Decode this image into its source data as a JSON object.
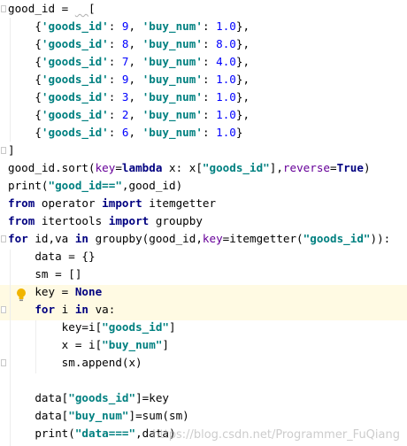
{
  "code_lines": [
    [
      {
        "t": "good_id = "
      },
      {
        "t": "  ",
        "c": "squig"
      },
      {
        "t": "["
      }
    ],
    [
      {
        "t": "    {"
      },
      {
        "t": "'goods_id'",
        "c": "str"
      },
      {
        "t": ": "
      },
      {
        "t": "9",
        "c": "num"
      },
      {
        "t": ", "
      },
      {
        "t": "'buy_num'",
        "c": "str"
      },
      {
        "t": ": "
      },
      {
        "t": "1.0",
        "c": "num"
      },
      {
        "t": "},"
      }
    ],
    [
      {
        "t": "    {"
      },
      {
        "t": "'goods_id'",
        "c": "str"
      },
      {
        "t": ": "
      },
      {
        "t": "8",
        "c": "num"
      },
      {
        "t": ", "
      },
      {
        "t": "'buy_num'",
        "c": "str"
      },
      {
        "t": ": "
      },
      {
        "t": "8.0",
        "c": "num"
      },
      {
        "t": "},"
      }
    ],
    [
      {
        "t": "    {"
      },
      {
        "t": "'goods_id'",
        "c": "str"
      },
      {
        "t": ": "
      },
      {
        "t": "7",
        "c": "num"
      },
      {
        "t": ", "
      },
      {
        "t": "'buy_num'",
        "c": "str"
      },
      {
        "t": ": "
      },
      {
        "t": "4.0",
        "c": "num"
      },
      {
        "t": "},"
      }
    ],
    [
      {
        "t": "    {"
      },
      {
        "t": "'goods_id'",
        "c": "str"
      },
      {
        "t": ": "
      },
      {
        "t": "9",
        "c": "num"
      },
      {
        "t": ", "
      },
      {
        "t": "'buy_num'",
        "c": "str"
      },
      {
        "t": ": "
      },
      {
        "t": "1.0",
        "c": "num"
      },
      {
        "t": "},"
      }
    ],
    [
      {
        "t": "    {"
      },
      {
        "t": "'goods_id'",
        "c": "str"
      },
      {
        "t": ": "
      },
      {
        "t": "3",
        "c": "num"
      },
      {
        "t": ", "
      },
      {
        "t": "'buy_num'",
        "c": "str"
      },
      {
        "t": ": "
      },
      {
        "t": "1.0",
        "c": "num"
      },
      {
        "t": "},"
      }
    ],
    [
      {
        "t": "    {"
      },
      {
        "t": "'goods_id'",
        "c": "str"
      },
      {
        "t": ": "
      },
      {
        "t": "2",
        "c": "num"
      },
      {
        "t": ", "
      },
      {
        "t": "'buy_num'",
        "c": "str"
      },
      {
        "t": ": "
      },
      {
        "t": "1.0",
        "c": "num"
      },
      {
        "t": "},"
      }
    ],
    [
      {
        "t": "    {"
      },
      {
        "t": "'goods_id'",
        "c": "str"
      },
      {
        "t": ": "
      },
      {
        "t": "6",
        "c": "num"
      },
      {
        "t": ", "
      },
      {
        "t": "'buy_num'",
        "c": "str"
      },
      {
        "t": ": "
      },
      {
        "t": "1.0",
        "c": "num"
      },
      {
        "t": "}"
      }
    ],
    [
      {
        "t": "]"
      }
    ],
    [
      {
        "t": "good_id.sort("
      },
      {
        "t": "key",
        "c": "kwarg"
      },
      {
        "t": "="
      },
      {
        "t": "lambda",
        "c": "kw"
      },
      {
        "t": " x: x["
      },
      {
        "t": "\"goods_id\"",
        "c": "str"
      },
      {
        "t": "],"
      },
      {
        "t": "reverse",
        "c": "kwarg"
      },
      {
        "t": "="
      },
      {
        "t": "True",
        "c": "kw"
      },
      {
        "t": ")"
      }
    ],
    [
      {
        "t": "print("
      },
      {
        "t": "\"good_id==\"",
        "c": "str"
      },
      {
        "t": ",good_id)"
      }
    ],
    [
      {
        "t": "from",
        "c": "kw"
      },
      {
        "t": " operator "
      },
      {
        "t": "import",
        "c": "kw"
      },
      {
        "t": " itemgetter"
      }
    ],
    [
      {
        "t": "from",
        "c": "kw"
      },
      {
        "t": " itertools "
      },
      {
        "t": "import",
        "c": "kw"
      },
      {
        "t": " groupby"
      }
    ],
    [
      {
        "t": "for",
        "c": "kw"
      },
      {
        "t": " id,va "
      },
      {
        "t": "in",
        "c": "kw"
      },
      {
        "t": " groupby(good_id,"
      },
      {
        "t": "key",
        "c": "kwarg"
      },
      {
        "t": "=itemgetter("
      },
      {
        "t": "\"goods_id\"",
        "c": "str"
      },
      {
        "t": ")):"
      }
    ],
    [
      {
        "t": "    data = {}"
      }
    ],
    [
      {
        "t": "    sm = []"
      }
    ],
    [
      {
        "t": "    key = "
      },
      {
        "t": "None",
        "c": "kw"
      }
    ],
    [
      {
        "t": "    "
      },
      {
        "t": "for",
        "c": "kw"
      },
      {
        "t": " i "
      },
      {
        "t": "in",
        "c": "kw"
      },
      {
        "t": " va:"
      }
    ],
    [
      {
        "t": "        key=i["
      },
      {
        "t": "\"goods_id\"",
        "c": "str"
      },
      {
        "t": "]"
      }
    ],
    [
      {
        "t": "        x = i["
      },
      {
        "t": "\"buy_num\"",
        "c": "str"
      },
      {
        "t": "]"
      }
    ],
    [
      {
        "t": "        sm.append(x)"
      }
    ],
    [
      {
        "t": ""
      }
    ],
    [
      {
        "t": "    data["
      },
      {
        "t": "\"goods_id\"",
        "c": "str"
      },
      {
        "t": "]=key"
      }
    ],
    [
      {
        "t": "    data["
      },
      {
        "t": "\"buy_num\"",
        "c": "str"
      },
      {
        "t": "]=sum(sm)"
      }
    ],
    [
      {
        "t": "    print("
      },
      {
        "t": "\"data===\"",
        "c": "str"
      },
      {
        "t": ",data)"
      }
    ]
  ],
  "watermark": "https://blog.csdn.net/Programmer_FuQiang",
  "colors": {
    "keyword": "#000080",
    "string": "#008080",
    "number": "#0000ff",
    "kwarg": "#660099",
    "current_line": "#fffae3"
  },
  "icons": {
    "intention_bulb": "lightbulb-icon",
    "fold_markers": "fold-marker-icon"
  }
}
